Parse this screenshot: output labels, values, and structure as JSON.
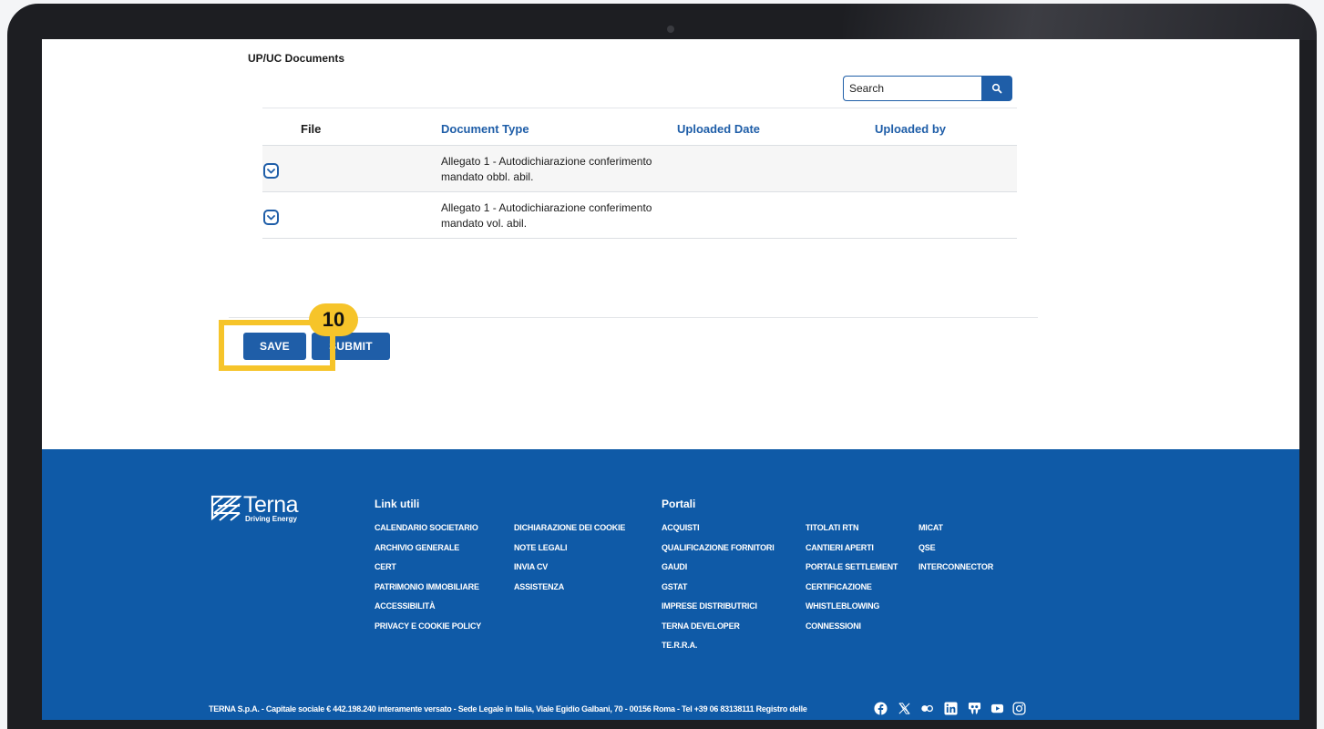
{
  "section_title": "UP/UC Documents",
  "search": {
    "placeholder": "Search"
  },
  "table": {
    "headers": {
      "file": "File",
      "document_type": "Document Type",
      "uploaded_date": "Uploaded Date",
      "uploaded_by": "Uploaded by"
    },
    "rows": [
      {
        "document_type": "Allegato 1 - Autodichiarazione conferimento mandato obbl. abil.",
        "uploaded_date": "",
        "uploaded_by": ""
      },
      {
        "document_type": "Allegato 1 - Autodichiarazione conferimento mandato vol. abil.",
        "uploaded_date": "",
        "uploaded_by": ""
      }
    ]
  },
  "actions": {
    "save_label": "SAVE",
    "submit_label": "SUBMIT"
  },
  "annotation": {
    "step_number": "10",
    "color": "#f6c42a"
  },
  "footer": {
    "logo_word": "Terna",
    "logo_tagline": "Driving Energy",
    "link_utili_title": "Link utili",
    "link_utili_col1": [
      "CALENDARIO SOCIETARIO",
      "ARCHIVIO GENERALE",
      "CERT",
      "PATRIMONIO IMMOBILIARE",
      "ACCESSIBILITÀ",
      "PRIVACY E COOKIE POLICY"
    ],
    "link_utili_col2": [
      "DICHIARAZIONE DEI COOKIE",
      "NOTE LEGALI",
      "INVIA CV",
      "ASSISTENZA"
    ],
    "portali_title": "Portali",
    "portali_col1": [
      "ACQUISTI",
      "QUALIFICAZIONE FORNITORI",
      "GAUDI",
      "GSTAT",
      "IMPRESE DISTRIBUTRICI",
      "TERNA DEVELOPER",
      "TE.R.R.A."
    ],
    "portali_col2": [
      "TITOLATI RTN",
      "CANTIERI APERTI",
      "PORTALE SETTLEMENT",
      "CERTIFICAZIONE",
      "WHISTLEBLOWING",
      "CONNESSIONI"
    ],
    "portali_col3": [
      "MICAT",
      "QSE",
      "INTERCONNECTOR"
    ],
    "legal_text": "TERNA S.p.A. - Capitale sociale € 442.198.240 interamente versato - Sede Legale in Italia, Viale Egidio Galbani, 70 - 00156 Roma - Tel +39 06 83138111 Registro delle",
    "social_icons": [
      "facebook-icon",
      "x-icon",
      "flickr-icon",
      "linkedin-icon",
      "slideshare-icon",
      "youtube-icon",
      "instagram-icon"
    ]
  },
  "colors": {
    "brand_blue": "#1f5ea8",
    "footer_blue": "#0f5aa7"
  }
}
